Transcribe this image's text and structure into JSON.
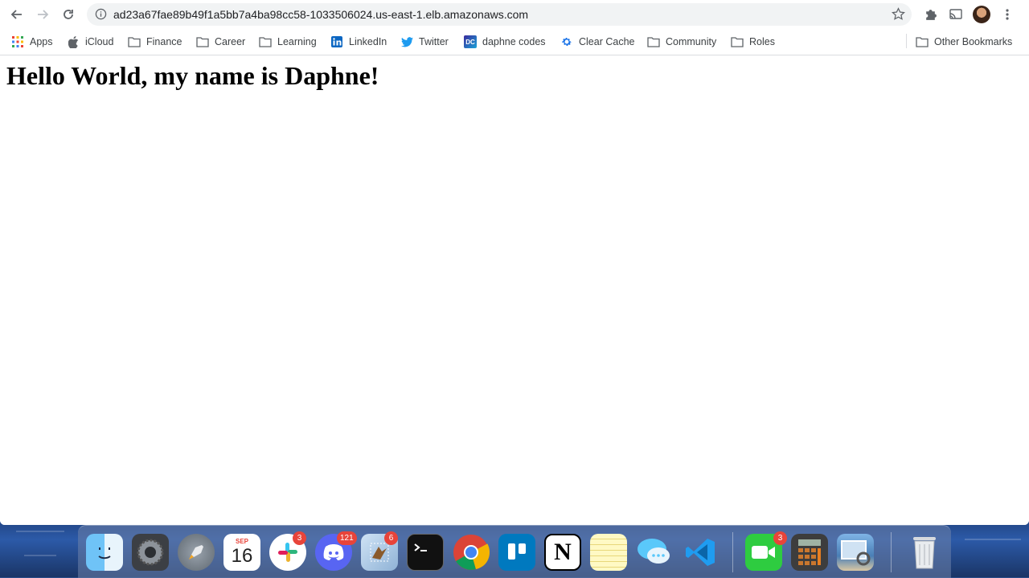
{
  "browser": {
    "url": "ad23a67fae89b49f1a5bb7a4ba98cc58-1033506024.us-east-1.elb.amazonaws.com"
  },
  "bookmarks": [
    {
      "label": "Apps",
      "icon": "apps-grid-icon"
    },
    {
      "label": "iCloud",
      "icon": "apple-icon"
    },
    {
      "label": "Finance",
      "icon": "folder-icon"
    },
    {
      "label": "Career",
      "icon": "folder-icon"
    },
    {
      "label": "Learning",
      "icon": "folder-icon"
    },
    {
      "label": "LinkedIn",
      "icon": "linkedin-icon"
    },
    {
      "label": "Twitter",
      "icon": "twitter-icon"
    },
    {
      "label": "daphne codes",
      "icon": "dc-icon"
    },
    {
      "label": "Clear Cache",
      "icon": "gear-icon"
    },
    {
      "label": "Community",
      "icon": "folder-icon"
    },
    {
      "label": "Roles",
      "icon": "folder-icon"
    }
  ],
  "other_bookmarks": "Other Bookmarks",
  "page": {
    "heading": "Hello World, my name is Daphne!"
  },
  "dock": {
    "calendar_month": "SEP",
    "calendar_day": "16",
    "badges": {
      "slack": "3",
      "discord": "121",
      "mail": "6",
      "facetime": "3"
    }
  },
  "colors": {
    "slack_badge": "#e8443a",
    "omnibox_bg": "#f1f3f4"
  }
}
